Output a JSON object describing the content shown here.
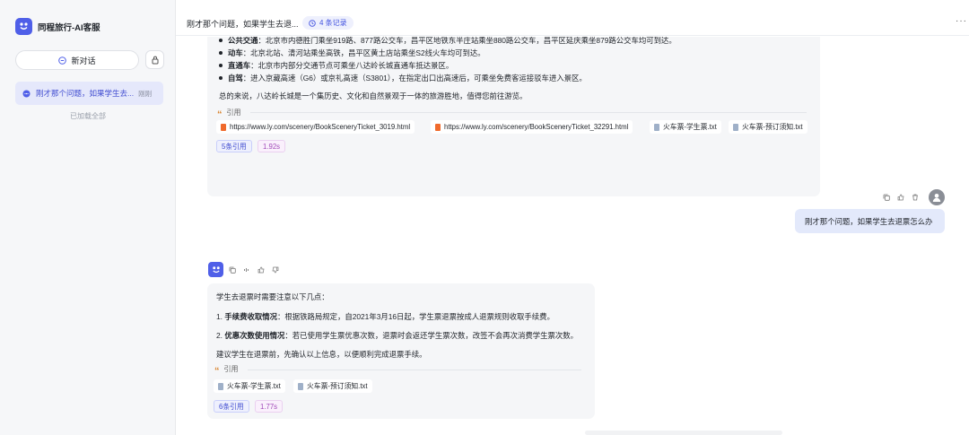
{
  "sidebar": {
    "brand_title": "同程旅行-AI客服",
    "new_chat_label": "新对话",
    "history": [
      {
        "title": "刚才那个问题，如果学生去...",
        "time": "刚刚"
      }
    ],
    "loaded_all": "已加载全部"
  },
  "header": {
    "title": "刚才那个问题，如果学生去退...",
    "records": "4 条记录",
    "more": "···"
  },
  "messages": {
    "bot1": {
      "lines": [
        {
          "label": "公共交通",
          "text": "：北京市内德胜门乘坐919路、877路公交车，昌平区地铁东半庄站乘坐880路公交车，昌平区延庆乘坐879路公交车均可到达。"
        },
        {
          "label": "动车",
          "text": "：北京北站、清河站乘坐高铁，昌平区黄土店站乘坐S2线火车均可到达。"
        },
        {
          "label": "直通车",
          "text": "：北京市内部分交通节点可乘坐八达岭长城直通车抵达景区。"
        },
        {
          "label": "自驾",
          "text": "：进入京藏高速（G6）或京礼高速（S3801），在指定出口出高速后，可乘坐免费客运接驳车进入景区。"
        }
      ],
      "summary": "总的来说，八达岭长城是一个集历史、文化和自然景观于一体的旅游胜地，值得您前往游览。",
      "cite_label": "引用",
      "sources": [
        {
          "name": "https://www.ly.com/scenery/BookSceneryTicket_3019.html",
          "type": "html"
        },
        {
          "name": "https://www.ly.com/scenery/BookSceneryTicket_32291.html",
          "type": "html"
        },
        {
          "name": "火车票-学生票.txt",
          "type": "txt"
        },
        {
          "name": "火车票-预订须知.txt",
          "type": "txt"
        }
      ],
      "cite_count": "5条引用",
      "elapsed": "1.92s"
    },
    "user": {
      "text": "刚才那个问题，如果学生去退票怎么办"
    },
    "bot2": {
      "intro": "学生去退票时需要注意以下几点：",
      "points": [
        {
          "num": "1.",
          "label": "手续费收取情况",
          "text": "：根据铁路局规定，自2021年3月16日起，学生票退票按成人退票规则收取手续费。"
        },
        {
          "num": "2.",
          "label": "优惠次数使用情况",
          "text": "：若已使用学生票优惠次数，退票时会返还学生票次数，改签不会再次消费学生票次数。"
        }
      ],
      "conclusion": "建议学生在退票前，先确认以上信息，以便顺利完成退票手续。",
      "cite_label": "引用",
      "sources": [
        {
          "name": "火车票-学生票.txt",
          "type": "txt"
        },
        {
          "name": "火车票-预订须知.txt",
          "type": "txt"
        }
      ],
      "cite_count": "6条引用",
      "elapsed": "1.77s"
    }
  },
  "colors": {
    "accent": "#4f5fe8",
    "sidebar_bg": "#f6f7f9",
    "selected_bg": "#e5e8fb",
    "bubble_bg": "#f5f6f8",
    "user_bubble_bg": "#e3e9fb",
    "quote_orange": "#d9822b"
  },
  "icons": [
    "brand-logo-icon",
    "chat-plus-icon",
    "sidebar-toggle-icon",
    "chat-bubble-icon",
    "clock-icon",
    "more-icon",
    "quote-icon",
    "file-icon",
    "copy-icon",
    "like-icon",
    "delete-icon",
    "user-avatar-icon",
    "bot-avatar-icon",
    "speaker-icon",
    "dislike-icon"
  ]
}
